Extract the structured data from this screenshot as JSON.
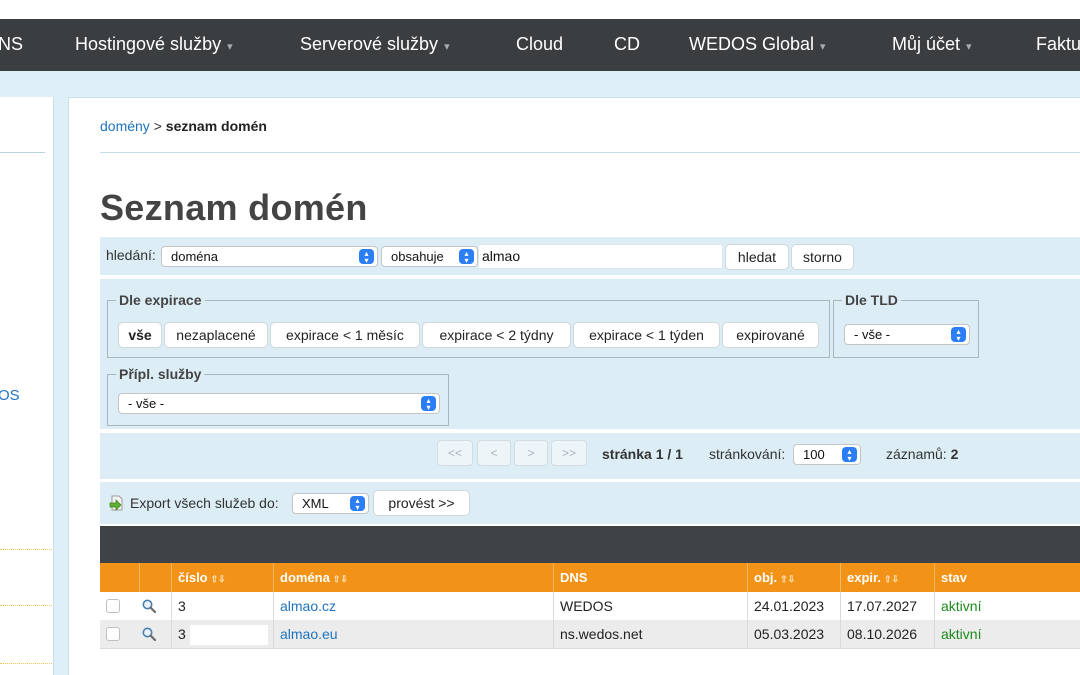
{
  "nav": {
    "items": [
      {
        "label": "NS",
        "caret": false
      },
      {
        "label": "Hostingové služby",
        "caret": true
      },
      {
        "label": "Serverové služby",
        "caret": true
      },
      {
        "label": "Cloud",
        "caret": false
      },
      {
        "label": "CD",
        "caret": false
      },
      {
        "label": "WEDOS Global",
        "caret": true
      },
      {
        "label": "Můj účet",
        "caret": true
      },
      {
        "label": "Faktu",
        "caret": false
      }
    ],
    "caret_glyph": "▾"
  },
  "sidebar": {
    "partial_label": "OS"
  },
  "breadcrumb": {
    "link": "domény",
    "separator": " > ",
    "current": "seznam domén"
  },
  "page_title": "Seznam domén",
  "search": {
    "label": "hledání:",
    "field_select": "doména",
    "operator_select": "obsahuje",
    "query_value": "almao",
    "search_button": "hledat",
    "cancel_button": "storno"
  },
  "filters": {
    "expiry": {
      "legend": "Dle expirace",
      "buttons": [
        "vše",
        "nezaplacené",
        "expirace < 1 měsíc",
        "expirace < 2 týdny",
        "expirace < 1 týden",
        "expirované"
      ],
      "active": "vše"
    },
    "tld": {
      "legend": "Dle TLD",
      "value": "- vše -"
    },
    "addons": {
      "legend": "Přípl. služby",
      "value": "- vše -"
    }
  },
  "pager": {
    "buttons": [
      "<<",
      "<",
      ">",
      ">>"
    ],
    "page_text": "stránka 1 / 1",
    "per_page_label": "stránkování:",
    "per_page_value": "100",
    "records_label": "záznamů:",
    "records_value": "2"
  },
  "export": {
    "label": "Export všech služeb do:",
    "format_value": "XML",
    "run_button": "provést >>"
  },
  "table": {
    "columns": [
      {
        "label": "",
        "sortable": false
      },
      {
        "label": "",
        "sortable": false
      },
      {
        "label": "číslo",
        "sortable": true
      },
      {
        "label": "doména",
        "sortable": true
      },
      {
        "label": "DNS",
        "sortable": false
      },
      {
        "label": "obj.",
        "sortable": true
      },
      {
        "label": "expir.",
        "sortable": true
      },
      {
        "label": "stav",
        "sortable": false
      }
    ],
    "sort_glyphs": "⇧⇩",
    "rows": [
      {
        "number": "3",
        "domain": "almao.cz",
        "dns": "WEDOS",
        "ordered": "24.01.2023",
        "expires": "17.07.2027",
        "status": "aktivní"
      },
      {
        "number": "3",
        "domain": "almao.eu",
        "dns": "ns.wedos.net",
        "ordered": "05.03.2023",
        "expires": "08.10.2026",
        "status": "aktivní"
      }
    ]
  },
  "colors": {
    "nav_bg": "#3b3e41",
    "page_bg": "#dfeff7",
    "panel_bg": "#dcedf5",
    "table_header": "#f29216",
    "table_dark_bar": "#3f4246",
    "link": "#1e73be",
    "status_active": "#1d8a1d",
    "select_arrow": "#2b7ef6"
  }
}
